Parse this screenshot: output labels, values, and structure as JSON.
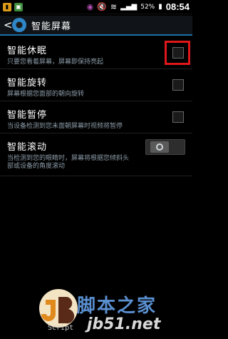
{
  "status_bar": {
    "time": "08:54",
    "battery": "52%",
    "notifications": [
      "sim-icon",
      "photo-icon",
      "security-icon"
    ]
  },
  "header": {
    "back": "<",
    "title": "智能屏幕"
  },
  "settings": [
    {
      "title": "智能休眠",
      "desc": "只要您看着屏幕，屏幕即保持亮起",
      "control": "checkbox",
      "checked": false,
      "highlighted": true
    },
    {
      "title": "智能旋转",
      "desc": "屏幕根据您面部的朝向旋转",
      "control": "checkbox",
      "checked": false
    },
    {
      "title": "智能暂停",
      "desc": "当设备检测到您未面朝屏幕时视频将暂停",
      "control": "checkbox",
      "checked": false
    },
    {
      "title": "智能滚动",
      "desc": "当检测到您的眼睛时，屏幕将根据您倾斜头部或设备的角度滚动",
      "control": "toggle",
      "on": false
    }
  ],
  "watermark": {
    "main": "脚本之家",
    "url": "jb51.net",
    "script": "Script"
  }
}
